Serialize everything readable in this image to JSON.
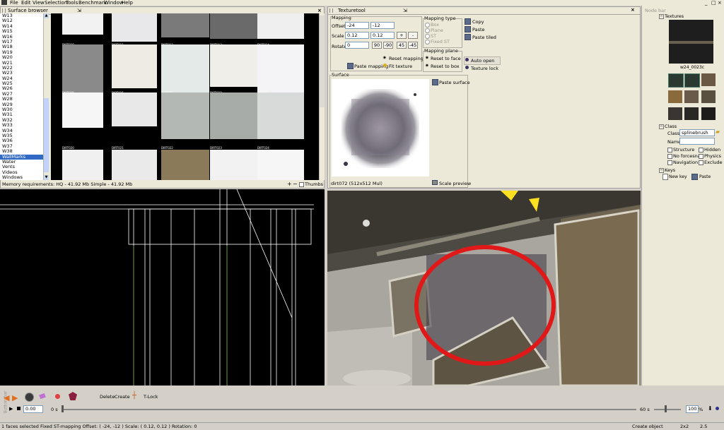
{
  "menu": [
    "File",
    "Edit",
    "View",
    "Selection",
    "Tools",
    "Benchmark",
    "Window",
    "Help"
  ],
  "window_controls": {
    "minimize": "_",
    "maximize": "□",
    "close": "×"
  },
  "surface_browser": {
    "title": "Surface browser",
    "list_items": [
      "W13",
      "W12",
      "W14",
      "W15",
      "W16",
      "W17",
      "W18",
      "W19",
      "W20",
      "W21",
      "W22",
      "W23",
      "W24",
      "W25",
      "W26",
      "W27",
      "W28",
      "W29",
      "W30",
      "W31",
      "W32",
      "W33",
      "W34",
      "W35",
      "W36",
      "W37",
      "W38",
      "WallMarks",
      "Water",
      "Vents",
      "Videos",
      "Windows"
    ],
    "selected_item": "WallMarks",
    "thumb_labels": [
      "DIRT010",
      "DIRT011",
      "DIRT012",
      "DIRT013",
      "DIRT014",
      "DIRT015",
      "DIRT016",
      "DIRT017",
      "DIRT018",
      "DIRT019",
      "DIRT020",
      "DIRT021",
      "DIRT022",
      "DIRT023",
      "DIRT024"
    ],
    "memory_text": "Memory requirements: HQ - 41.92 Mb   Simple - 41.92 Mb",
    "zoom_in": "+",
    "zoom_out": "−",
    "thumbs_label": "Thumbs"
  },
  "texturetool": {
    "title": "Texturetool",
    "mapping_title": "Mapping",
    "offset_label": "Offset",
    "offset_x": "-24",
    "offset_y": "-12",
    "scale_label": "Scale",
    "scale_x": "0.12",
    "scale_y": "0.12",
    "rotate_label": "Rotate",
    "rotate_value": "0",
    "plus": "+",
    "minus": "-",
    "rot_90": "90",
    "rot_m90": "-90",
    "rot_45": "45",
    "rot_m45": "-45",
    "reset_mapping": "Reset mapping",
    "paste_mapping": "Paste mapping",
    "fit_texture": "Fit texture",
    "mapping_type_title": "Mapping type",
    "mapping_types": [
      "Box",
      "Plane",
      "ST",
      "Fixed ST"
    ],
    "mapping_plane_title": "Mapping plane",
    "reset_to_face": "Reset to face",
    "reset_to_box": "Reset to box",
    "copy": "Copy",
    "paste": "Paste",
    "paste_tiled": "Paste tiled",
    "auto_open": "Auto open",
    "texture_lock": "Texture lock",
    "surface_title": "Surface",
    "paste_surface": "Paste surface",
    "surface_name": "dirt072 (512x512 Mul)",
    "scale_preview": "Scale preview"
  },
  "node_bar": {
    "title": "Node bar",
    "textures_title": "Textures",
    "main_texture_name": "w24_0023c",
    "class_title": "Class",
    "class_label": "Class",
    "class_value": "splinebrush",
    "name_label": "Name",
    "name_value": "",
    "checks": {
      "structure": "Structure",
      "hidden": "Hidden",
      "no_forcesnap": "No forcesnap",
      "physics": "Physics",
      "navigation": "Navigation",
      "exclude": "Exclude"
    },
    "keys_title": "Keys",
    "new_key": "New key",
    "paste_key": "Paste"
  },
  "button_bar": {
    "side_label": "Button bar",
    "delete": "Delete",
    "create": "Create",
    "tlock": "T-Lock",
    "time_value": "0.00",
    "time_unit": "0 s",
    "time_end": "60 s",
    "zoom_value": "100",
    "zoom_unit": "%"
  },
  "status_bar": {
    "selection": "1 faces selected  Fixed ST-mapping  Offset: ( -24, -12 )  Scale: ( 0.12, 0.12 )  Rotation: 0",
    "mode": "Create object",
    "grid": "2x2",
    "snap": "2.5"
  },
  "colors": {
    "highlight": "#ff0000",
    "selected": "#316ac5",
    "wire": "#ffffff"
  }
}
